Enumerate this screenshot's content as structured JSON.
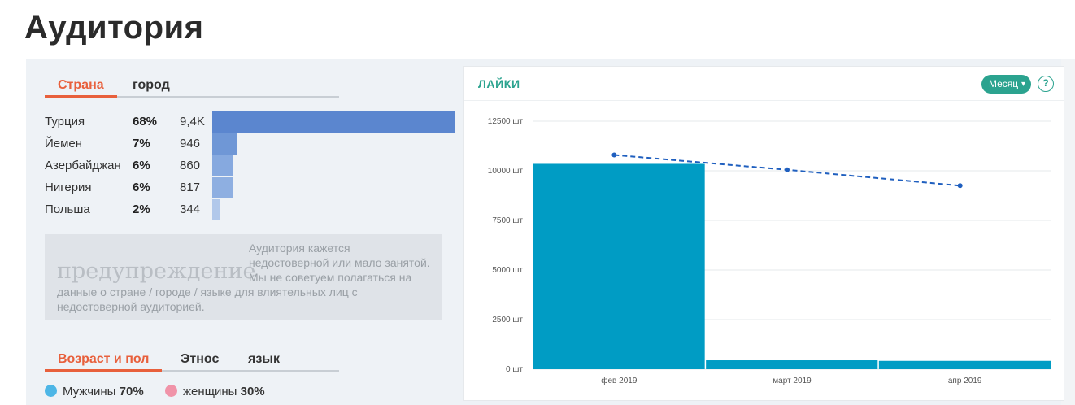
{
  "page": {
    "title": "Аудитория"
  },
  "geo_tabs": [
    {
      "label": "Страна",
      "active": true
    },
    {
      "label": "город",
      "active": false
    }
  ],
  "countries": [
    {
      "name": "Турция",
      "percent": "68%",
      "count": "9,4K",
      "share": 0.68
    },
    {
      "name": "Йемен",
      "percent": "7%",
      "count": "946",
      "share": 0.07
    },
    {
      "name": "Азербайджан",
      "percent": "6%",
      "count": "860",
      "share": 0.06
    },
    {
      "name": "Нигерия",
      "percent": "6%",
      "count": "817",
      "share": 0.06
    },
    {
      "name": "Польша",
      "percent": "2%",
      "count": "344",
      "share": 0.02
    }
  ],
  "warning": {
    "watermark": "предупреждение",
    "line1": "Аудитория кажется",
    "line2": "недостоверной или мало занятой.",
    "line3": "Мы не советуем полагаться на",
    "line4": "данные о стране / городе / языке для влиятельных лиц с",
    "line5": "недостоверной аудиторией."
  },
  "demo_tabs": [
    {
      "label": "Возраст и пол",
      "active": true
    },
    {
      "label": "Этнос",
      "active": false
    },
    {
      "label": "язык",
      "active": false
    }
  ],
  "gender": {
    "male_label": "Мужчины",
    "male_pct": "70%",
    "male_color": "#4db6e6",
    "female_label": "женщины",
    "female_pct": "30%",
    "female_color": "#f093a8"
  },
  "likes_panel": {
    "title": "ЛАЙКИ",
    "period": "Месяц",
    "help": "?"
  },
  "colors": {
    "accent": "#e8603c",
    "teal": "#2ba38f",
    "bar": "#009cc4",
    "country_bars": [
      "#5b86cf",
      "#6f97d6",
      "#86a9df",
      "#8eafe1",
      "#b1c8ea"
    ],
    "trend": "#1f5fbf"
  },
  "chart_data": {
    "type": "bar",
    "categories": [
      "фев 2019",
      "март 2019",
      "апр 2019"
    ],
    "series": [
      {
        "values": [
          10350,
          450,
          420
        ]
      },
      {
        "type": "line",
        "style": "dashed",
        "values": [
          10800,
          10050,
          9250
        ]
      }
    ],
    "ylim": [
      0,
      12500
    ],
    "yticks": [
      0,
      2500,
      5000,
      7500,
      10000,
      12500
    ],
    "ytick_labels": [
      "0 шт",
      "2500 шт",
      "5000 шт",
      "7500 шт",
      "10000 шт",
      "12500 шт"
    ],
    "grid": true
  }
}
